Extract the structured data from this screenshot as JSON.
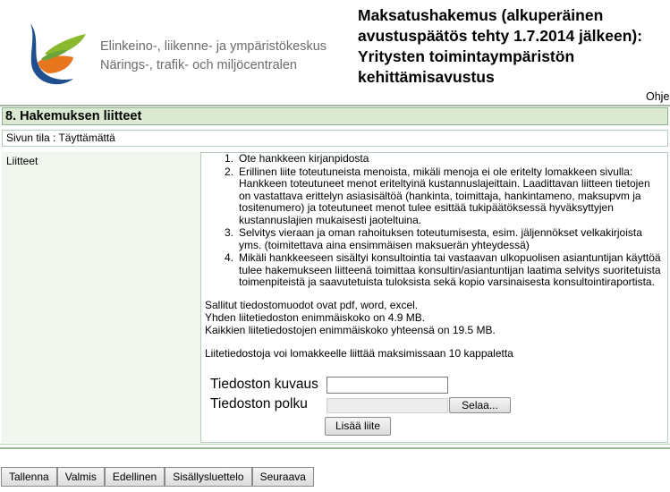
{
  "header": {
    "org_fi": "Elinkeino-, liikenne- ja ympäristökeskus",
    "org_sv": "Närings-, trafik- och miljöcentralen",
    "title": "Maksatushakemus (alkuperäinen avustuspäätös tehty 1.7.2014 jälkeen): Yritysten toimintaympäristön kehittämisavustus",
    "help_link": "Ohje"
  },
  "section": {
    "title": "8. Hakemuksen liitteet",
    "status": "Sivun tila : Täyttämättä",
    "left_label": "Liitteet"
  },
  "attachments_list": [
    {
      "num": "1.",
      "text": "Ote hankkeen kirjanpidosta"
    },
    {
      "num": "2.",
      "text": "Erillinen liite toteutuneista menoista, mikäli menoja ei ole eritelty lomakkeen sivulla: Hankkeen toteutuneet menot eriteltyinä kustannuslajeittain. Laadittavan liitteen tietojen on vastattava erittelyn asiasisältöä (hankinta, toimittaja, hankintameno, maksupvm ja tositenumero) ja toteutuneet menot tulee esittää tukipäätöksessä hyväksyttyjen kustannuslajien mukaisesti jaoteltuina."
    },
    {
      "num": "3.",
      "text": "Selvitys vieraan ja oman rahoituksen toteutumisesta, esim. jäljennökset velkakirjoista yms. (toimitettava aina ensimmäisen maksuerän yhteydessä)"
    },
    {
      "num": "4.",
      "text": "Mikäli hankkeeseen sisältyi konsultointia tai vastaavan ulkopuolisen asiantuntijan käyttöä tulee hakemukseen liitteenä toimittaa konsultin/asiantuntijan laatima selvitys suoritetuista toimenpiteistä ja saavutetuista tuloksista sekä kopio varsinaisesta konsultointiraportista."
    }
  ],
  "file_info": {
    "formats": "Sallitut tiedostomuodot ovat pdf, word, excel.",
    "max_single": "Yhden liitetiedoston enimmäiskoko on 4.9 MB.",
    "max_total": "Kaikkien liitetiedostojen enimmäiskoko yhteensä on 19.5 MB.",
    "max_count": "Liitetiedostoja voi lomakkeelle liittää maksimissaan 10 kappaletta"
  },
  "form": {
    "desc_label": "Tiedoston kuvaus",
    "desc_value": "",
    "path_label": "Tiedoston polku",
    "path_value": "",
    "browse_label": "Selaa...",
    "add_label": "Lisää liite"
  },
  "nav_buttons": [
    "Tallenna",
    "Valmis",
    "Edellinen",
    "Sisällysluettelo",
    "Seuraava"
  ],
  "colors": {
    "section_header_bg": "#dbe9d3",
    "border_green": "#9db89d",
    "left_col_bg": "#f1f6ee"
  },
  "icons": {
    "logo": "ely-centre-logo"
  }
}
